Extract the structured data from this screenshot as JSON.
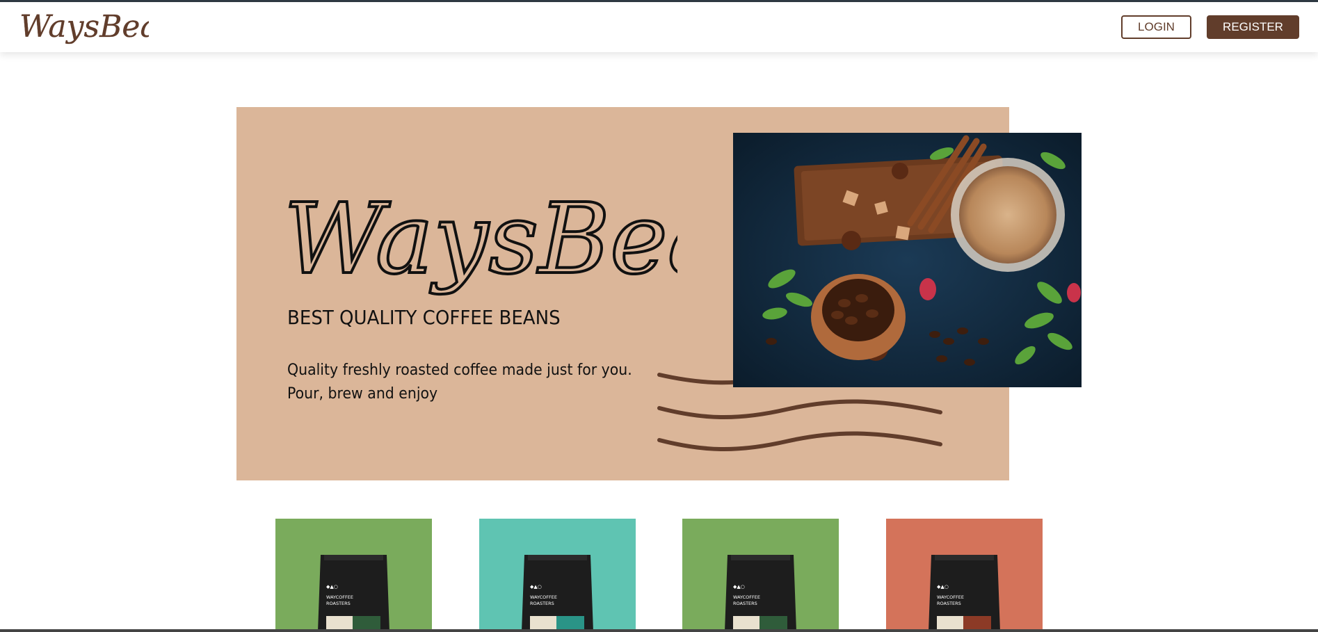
{
  "brand": {
    "name": "WaysBeans",
    "color": "#613d2b"
  },
  "navbar": {
    "login_label": "LOGIN",
    "register_label": "REGISTER"
  },
  "hero": {
    "background": "#dbb699",
    "subtitle": "BEST QUALITY COFFEE BEANS",
    "description_line1": "Quality freshly roasted coffee made just for you.",
    "description_line2": "Pour, brew and enjoy"
  },
  "products": [
    {
      "color": "#7aab5c",
      "label": "WAYCOFFEE ROASTERS"
    },
    {
      "color": "#5fc4b2",
      "label": "WAYCOFFEE ROASTERS"
    },
    {
      "color": "#7aab5c",
      "label": "WAYCOFFEE ROASTERS"
    },
    {
      "color": "#d4735a",
      "label": "WAYCOFFEE ROASTERS"
    }
  ]
}
